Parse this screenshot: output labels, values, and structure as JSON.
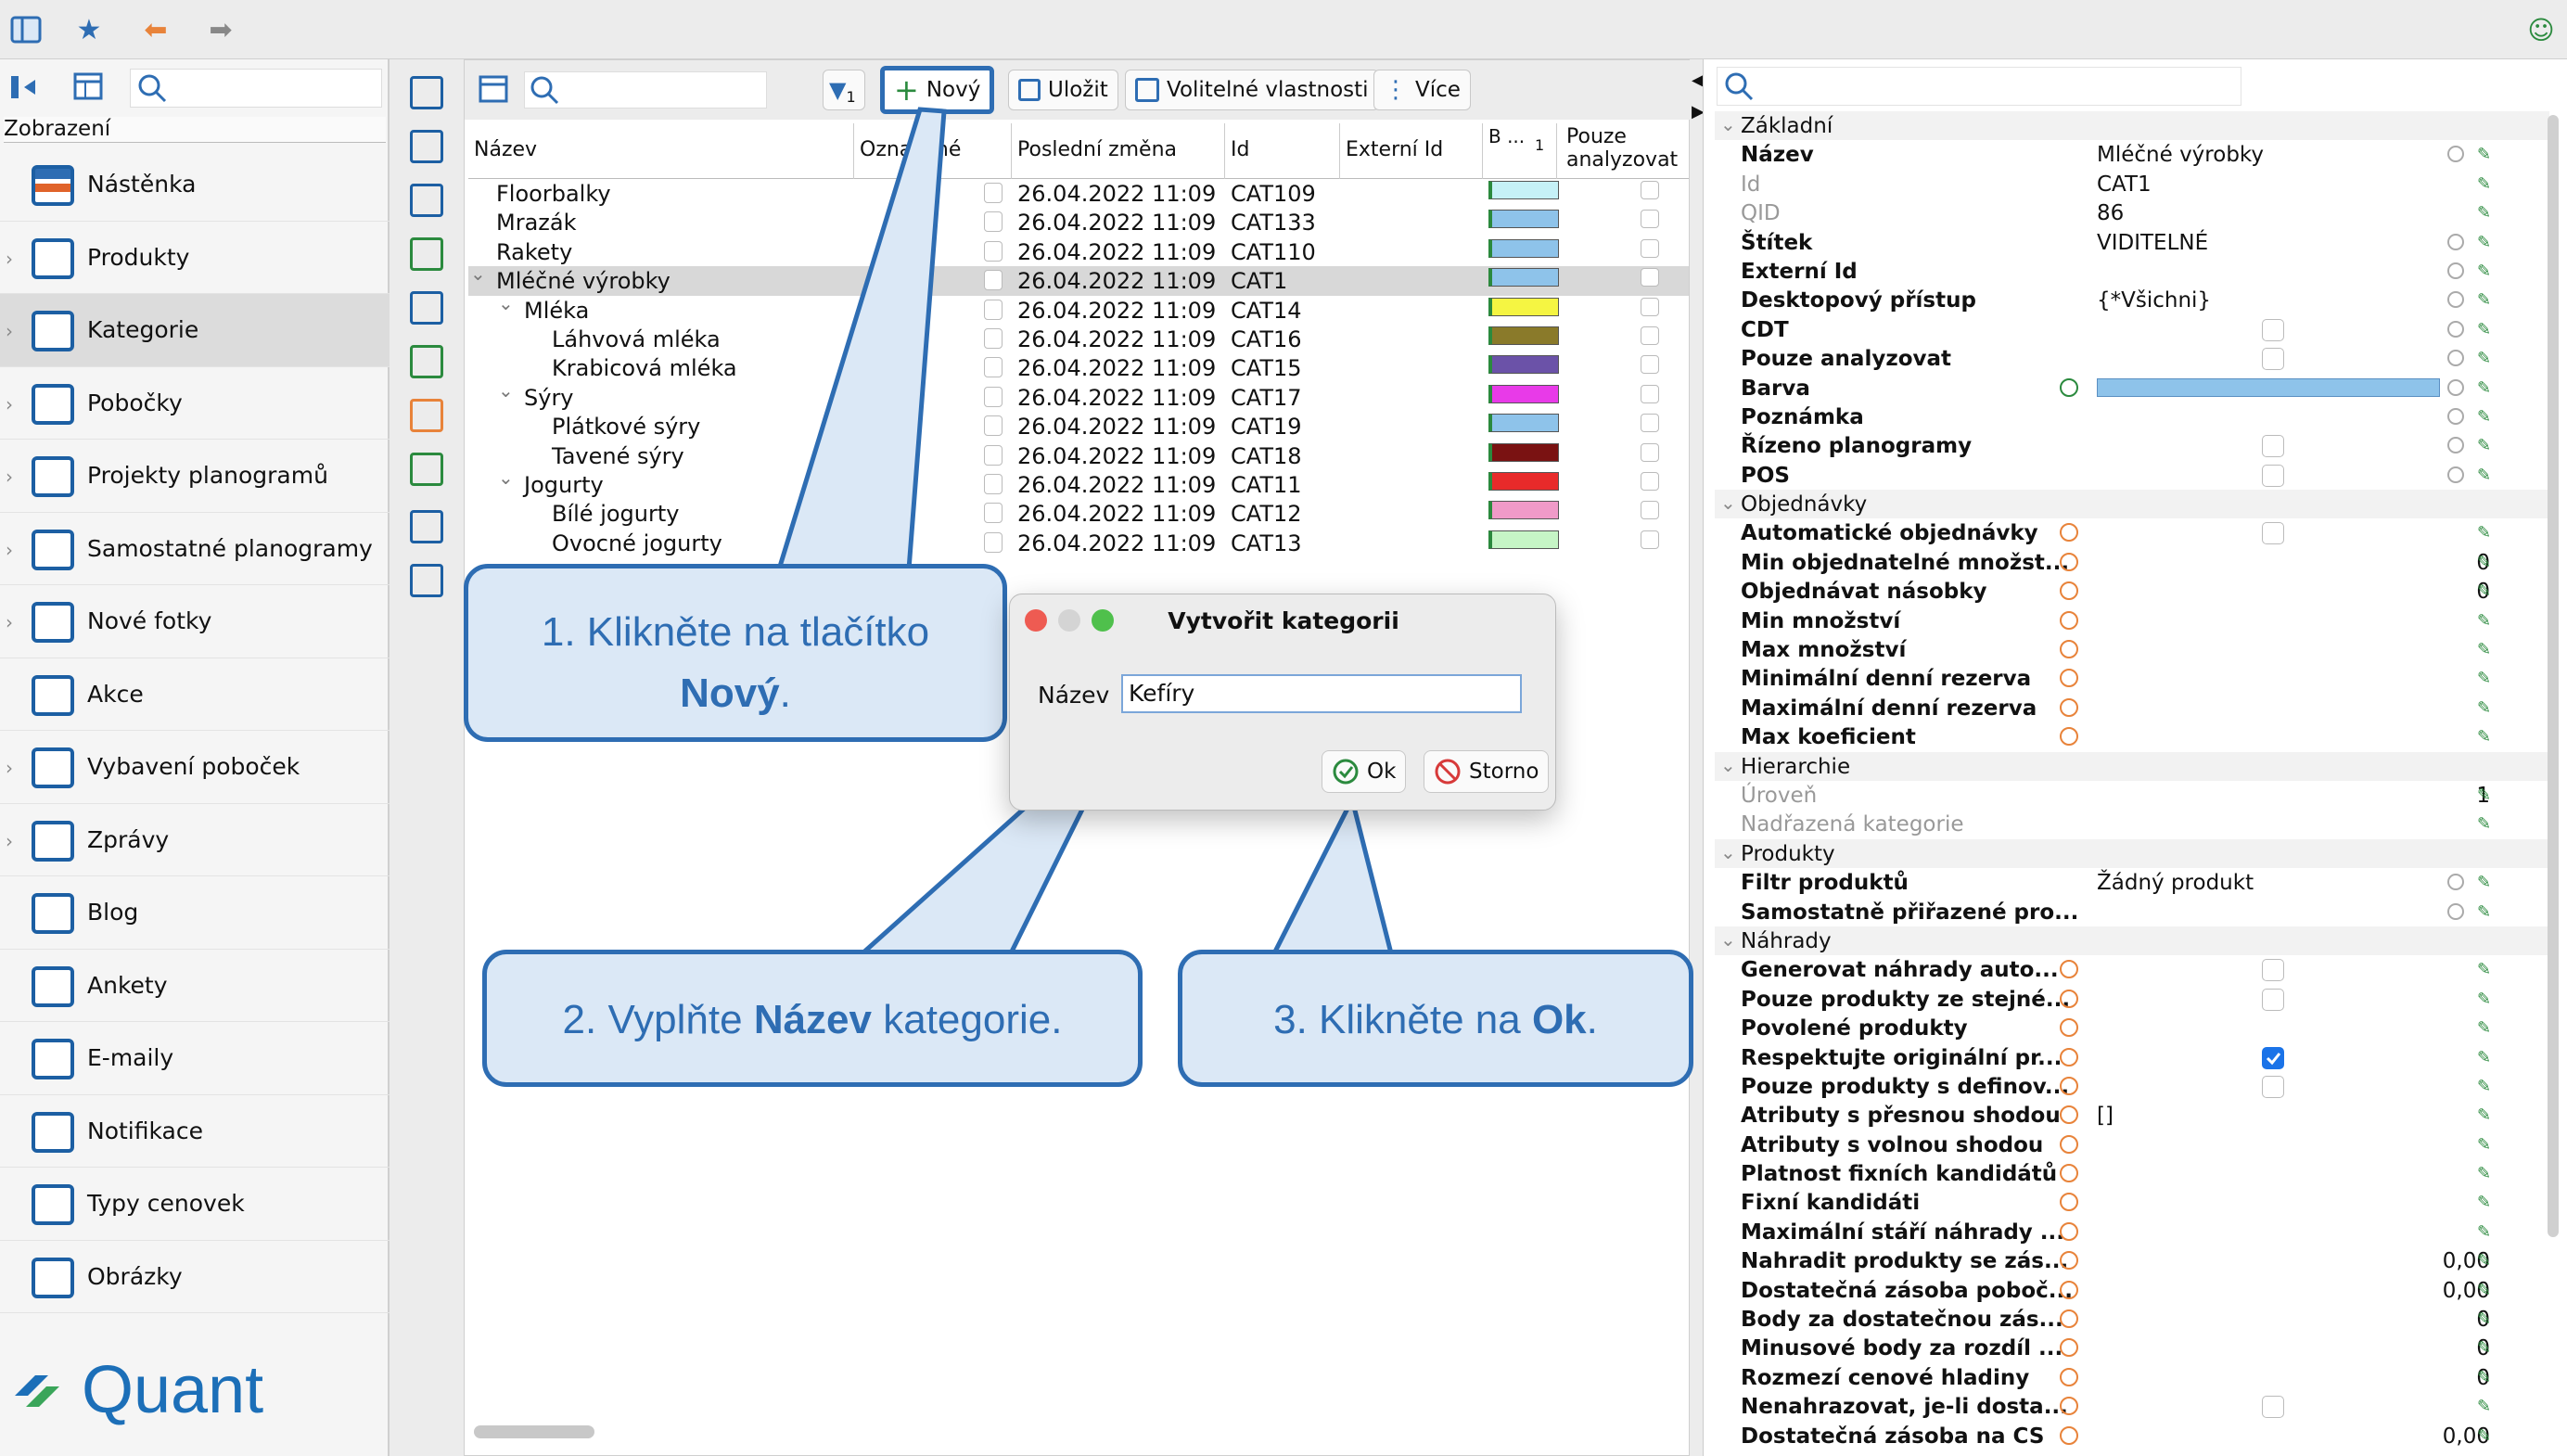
{
  "sidebar": {
    "section_label": "Zobrazení",
    "items": [
      {
        "label": "Nástěnka",
        "icon": "dashboard-icon",
        "chevron": false
      },
      {
        "label": "Produkty",
        "icon": "product-icon",
        "chevron": true
      },
      {
        "label": "Kategorie",
        "icon": "category-icon",
        "chevron": true,
        "active": true
      },
      {
        "label": "Pobočky",
        "icon": "store-icon",
        "chevron": true
      },
      {
        "label": "Projekty planogramů",
        "icon": "planogram-project-icon",
        "chevron": true
      },
      {
        "label": "Samostatné planogramy",
        "icon": "planogram-icon",
        "chevron": true
      },
      {
        "label": "Nové fotky",
        "icon": "camera-icon",
        "chevron": true
      },
      {
        "label": "Akce",
        "icon": "promo-icon",
        "chevron": false
      },
      {
        "label": "Vybavení poboček",
        "icon": "equipment-icon",
        "chevron": true
      },
      {
        "label": "Zprávy",
        "icon": "message-icon",
        "chevron": true
      },
      {
        "label": "Blog",
        "icon": "blog-icon",
        "chevron": false
      },
      {
        "label": "Ankety",
        "icon": "survey-icon",
        "chevron": false
      },
      {
        "label": "E-maily",
        "icon": "email-icon",
        "chevron": false
      },
      {
        "label": "Notifikace",
        "icon": "notification-icon",
        "chevron": false
      },
      {
        "label": "Typy cenovek",
        "icon": "price-tag-icon",
        "chevron": false
      },
      {
        "label": "Obrázky",
        "icon": "image-icon",
        "chevron": false
      }
    ],
    "logo_text": "Quant"
  },
  "toolbar": {
    "filter_badge": "1",
    "new_label": "Nový",
    "save_label": "Uložit",
    "custom_props_label": "Volitelné vlastnosti",
    "more_label": "Více"
  },
  "grid": {
    "columns": [
      "Název",
      "Označené",
      "Poslední změna",
      "Id",
      "Externí Id",
      "B ...",
      "1",
      "Pouze analyzovat"
    ],
    "rows": [
      {
        "name": "Floorbalky",
        "level": 0,
        "toggle": "",
        "date": "26.04.2022 11:09",
        "id": "CAT109",
        "color": "#c6f1f7"
      },
      {
        "name": "Mrazák",
        "level": 0,
        "toggle": "",
        "date": "26.04.2022 11:09",
        "id": "CAT133",
        "color": "#8ec3ea"
      },
      {
        "name": "Rakety",
        "level": 0,
        "toggle": "",
        "date": "26.04.2022 11:09",
        "id": "CAT110",
        "color": "#8ec3ea"
      },
      {
        "name": "Mléčné výrobky",
        "level": 0,
        "toggle": "⌄",
        "date": "26.04.2022 11:09",
        "id": "CAT1",
        "color": "#8ec3ea",
        "selected": true
      },
      {
        "name": "Mléka",
        "level": 1,
        "toggle": "⌄",
        "date": "26.04.2022 11:09",
        "id": "CAT14",
        "color": "#f5f542"
      },
      {
        "name": "Láhvová mléka",
        "level": 2,
        "toggle": "",
        "date": "26.04.2022 11:09",
        "id": "CAT16",
        "color": "#8a7a2a"
      },
      {
        "name": "Krabicová mléka",
        "level": 2,
        "toggle": "",
        "date": "26.04.2022 11:09",
        "id": "CAT15",
        "color": "#6b52a8"
      },
      {
        "name": "Sýry",
        "level": 1,
        "toggle": "⌄",
        "date": "26.04.2022 11:09",
        "id": "CAT17",
        "color": "#e83ae8"
      },
      {
        "name": "Plátkové sýry",
        "level": 2,
        "toggle": "",
        "date": "26.04.2022 11:09",
        "id": "CAT19",
        "color": "#8ec3ea"
      },
      {
        "name": "Tavené sýry",
        "level": 2,
        "toggle": "",
        "date": "26.04.2022 11:09",
        "id": "CAT18",
        "color": "#7a1212"
      },
      {
        "name": "Jogurty",
        "level": 1,
        "toggle": "⌄",
        "date": "26.04.2022 11:09",
        "id": "CAT11",
        "color": "#e82a2a"
      },
      {
        "name": "Bílé jogurty",
        "level": 2,
        "toggle": "",
        "date": "26.04.2022 11:09",
        "id": "CAT12",
        "color": "#f09ac8"
      },
      {
        "name": "Ovocné jogurty",
        "level": 2,
        "toggle": "",
        "date": "26.04.2022 11:09",
        "id": "CAT13",
        "color": "#c6f5c6"
      }
    ]
  },
  "dialog": {
    "title": "Vytvořit kategorii",
    "name_label": "Název",
    "name_value": "Kefíry",
    "ok_label": "Ok",
    "cancel_label": "Storno"
  },
  "callouts": {
    "c1_pre": "1. Klikněte na tlačítko",
    "c1_bold": "Nový",
    "c1_post": ".",
    "c2_pre": "2. Vyplňte ",
    "c2_bold": "Název",
    "c2_post": " kategorie.",
    "c3_pre": "3. Klikněte na ",
    "c3_bold": "Ok",
    "c3_post": "."
  },
  "props": [
    {
      "t": "sec",
      "name": "Základní"
    },
    {
      "name": "Název",
      "value": "Mléčné výrobky",
      "sync": true
    },
    {
      "name": "Id",
      "value": "CAT1",
      "dis": true
    },
    {
      "name": "QID",
      "value": "86",
      "dis": true
    },
    {
      "name": "Štítek",
      "value": "VIDITELNÉ",
      "sync": true
    },
    {
      "name": "Externí Id",
      "value": "",
      "sync": true
    },
    {
      "name": "Desktopový přístup",
      "value": "{*Všichni}",
      "sync": true
    },
    {
      "name": "CDT",
      "chk": "off",
      "sync": true
    },
    {
      "name": "Pouze analyzovat",
      "chk": "off",
      "sync": true
    },
    {
      "name": "Barva",
      "color": "#8ec3ea",
      "sync": true,
      "green": true
    },
    {
      "name": "Poznámka",
      "value": "",
      "sync": true
    },
    {
      "name": "Řízeno planogramy",
      "chk": "off",
      "sync": true
    },
    {
      "name": "POS",
      "chk": "off",
      "sync": true
    },
    {
      "t": "sec",
      "name": "Objednávky"
    },
    {
      "name": "Automatické objednávky",
      "chk": "off",
      "inh": true
    },
    {
      "name": "Min objednatelné množst...",
      "num": "0",
      "inh": true
    },
    {
      "name": "Objednávat násobky",
      "num": "0",
      "inh": true
    },
    {
      "name": "Min množství",
      "inh": true
    },
    {
      "name": "Max množství",
      "inh": true
    },
    {
      "name": "Minimální denní rezerva",
      "inh": true
    },
    {
      "name": "Maximální denní rezerva",
      "inh": true
    },
    {
      "name": "Max koeficient",
      "inh": true
    },
    {
      "t": "sec",
      "name": "Hierarchie"
    },
    {
      "name": "Úroveň",
      "num": "1",
      "dis": true
    },
    {
      "name": "Nadřazená kategorie",
      "dis": true
    },
    {
      "t": "sec",
      "name": "Produkty"
    },
    {
      "name": "Filtr produktů",
      "value": "Žádný produkt",
      "sync": true
    },
    {
      "name": "Samostatně přiřazené pro...",
      "sync": true
    },
    {
      "t": "sec",
      "name": "Náhrady"
    },
    {
      "name": "Generovat náhrady auto...",
      "chk": "off",
      "inh": true
    },
    {
      "name": "Pouze produkty ze stejné...",
      "chk": "off",
      "inh": true
    },
    {
      "name": "Povolené produkty",
      "inh": true
    },
    {
      "name": "Respektujte originální pr...",
      "chk": "on",
      "inh": true
    },
    {
      "name": "Pouze produkty s definov...",
      "chk": "off",
      "inh": true
    },
    {
      "name": "Atributy s přesnou shodou",
      "value": "[]",
      "inh": true
    },
    {
      "name": "Atributy s volnou shodou",
      "inh": true
    },
    {
      "name": "Platnost fixních kandidátů",
      "inh": true
    },
    {
      "name": "Fixní kandidáti",
      "inh": true
    },
    {
      "name": "Maximální stáří náhrady ...",
      "inh": true
    },
    {
      "name": "Nahradit produkty se zás...",
      "num": "0,00",
      "inh": true
    },
    {
      "name": "Dostatečná zásoba poboč...",
      "num": "0,00",
      "inh": true
    },
    {
      "name": "Body za dostatečnou zás...",
      "num": "0",
      "inh": true
    },
    {
      "name": "Minusové body za rozdíl ...",
      "num": "0",
      "inh": true
    },
    {
      "name": "Rozmezí cenové hladiny",
      "num": "0",
      "inh": true
    },
    {
      "name": "Nenahrazovat, je-li dosta...",
      "chk": "off",
      "inh": true
    },
    {
      "name": "Dostatečná zásoba na CS",
      "num": "0,00",
      "inh": true
    }
  ]
}
